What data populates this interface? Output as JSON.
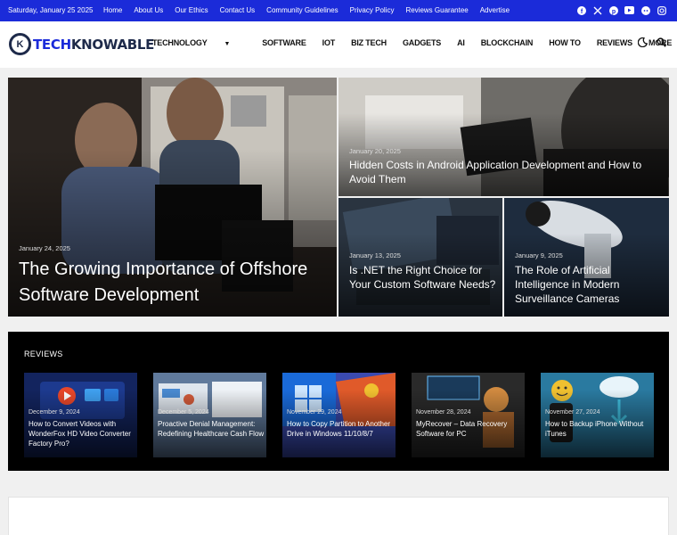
{
  "topbar": {
    "date": "Saturday, January 25 2025",
    "links": [
      "Home",
      "About Us",
      "Our Ethics",
      "Contact Us",
      "Community Guidelines",
      "Privacy Policy",
      "Reviews Guarantee",
      "Advertise"
    ],
    "social_icons": [
      "facebook-icon",
      "x-icon",
      "pinterest-icon",
      "youtube-icon",
      "reddit-icon",
      "instagram-icon"
    ]
  },
  "header": {
    "logo_part1": "TECH",
    "logo_part2": "KNOWABLE",
    "nav": [
      "TECHNOLOGY",
      "SOFTWARE",
      "IOT",
      "BIZ TECH",
      "GADGETS",
      "AI",
      "BLOCKCHAIN",
      "HOW TO",
      "REVIEWS",
      "MORE"
    ],
    "icons": [
      "dark-mode-icon",
      "search-icon"
    ]
  },
  "hero": {
    "main": {
      "date": "January 24, 2025",
      "title": "The Growing Importance of Offshore Software Development"
    },
    "right_top": {
      "date": "January 20, 2025",
      "title": "Hidden Costs in Android Application Development and How to Avoid Them"
    },
    "right_bottom_left": {
      "date": "January 13, 2025",
      "title": "Is .NET the Right Choice for Your Custom Software Needs?"
    },
    "right_bottom_right": {
      "date": "January 9, 2025",
      "title": "The Role of Artificial Intelligence in Modern Surveillance Cameras"
    }
  },
  "reviews": {
    "heading": "REVIEWS",
    "items": [
      {
        "date": "December 9, 2024",
        "title": "How to Convert Videos with WonderFox HD Video Converter Factory Pro?"
      },
      {
        "date": "December 5, 2024",
        "title": "Proactive Denial Management: Redefining Healthcare Cash Flow"
      },
      {
        "date": "November 29, 2024",
        "title": "How to Copy Partition to Another Drive in Windows 11/10/8/7"
      },
      {
        "date": "November 28, 2024",
        "title": "MyRecover – Data Recovery Software for PC"
      },
      {
        "date": "November 27, 2024",
        "title": "How to Backup iPhone Without iTunes"
      }
    ]
  },
  "colors": {
    "topbar": "#1b2bd9",
    "brand_dark": "#1e2a4a"
  }
}
